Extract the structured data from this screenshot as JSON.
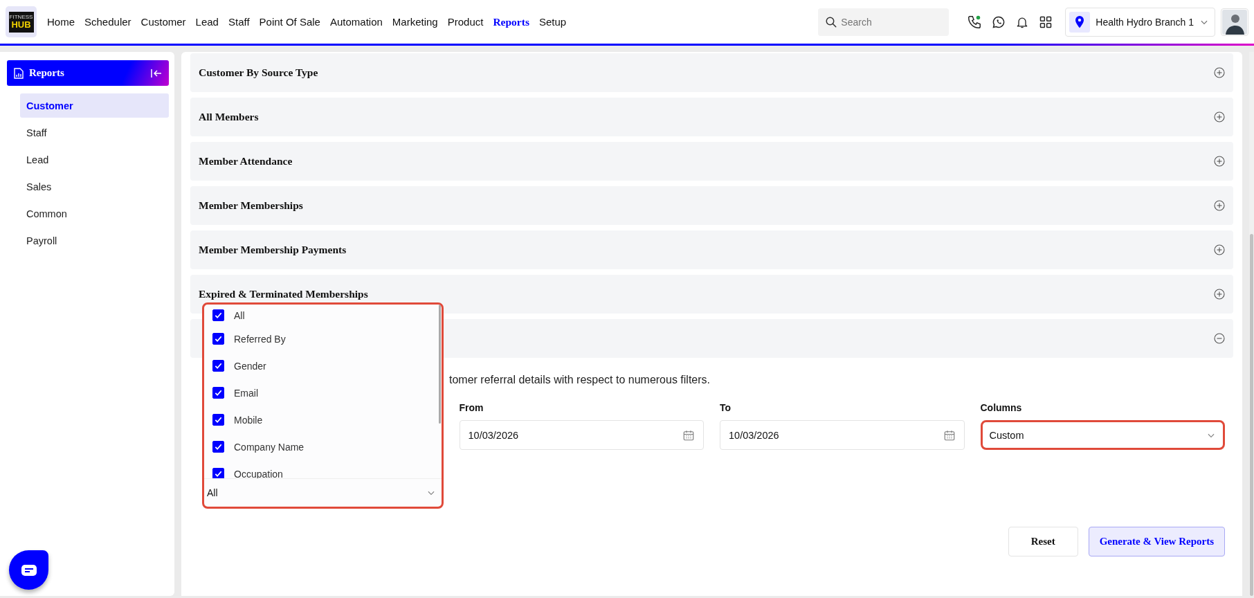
{
  "header": {
    "logo": {
      "lines": [
        "FITNESS",
        "HUB"
      ]
    },
    "nav": [
      {
        "label": "Home",
        "selected": false
      },
      {
        "label": "Scheduler",
        "selected": false
      },
      {
        "label": "Customer",
        "selected": false
      },
      {
        "label": "Lead",
        "selected": false
      },
      {
        "label": "Staff",
        "selected": false
      },
      {
        "label": "Point Of Sale",
        "selected": false
      },
      {
        "label": "Automation",
        "selected": false
      },
      {
        "label": "Marketing",
        "selected": false
      },
      {
        "label": "Product",
        "selected": false
      },
      {
        "label": "Reports",
        "selected": true
      },
      {
        "label": "Setup",
        "selected": false
      }
    ],
    "search": {
      "placeholder": "Search"
    },
    "branch": "Health Hydro Branch 1"
  },
  "sidebar": {
    "title": "Reports",
    "items": [
      {
        "label": "Customer",
        "selected": true
      },
      {
        "label": "Staff",
        "selected": false
      },
      {
        "label": "Lead",
        "selected": false
      },
      {
        "label": "Sales",
        "selected": false
      },
      {
        "label": "Common",
        "selected": false
      },
      {
        "label": "Payroll",
        "selected": false
      }
    ]
  },
  "sections": [
    {
      "title": "Customer By Source Type",
      "expanded": false
    },
    {
      "title": "All Members",
      "expanded": false
    },
    {
      "title": "Member Attendance",
      "expanded": false
    },
    {
      "title": "Member Memberships",
      "expanded": false
    },
    {
      "title": "Member Membership Payments",
      "expanded": false
    },
    {
      "title": "Expired & Terminated Memberships",
      "expanded": false
    },
    {
      "expanded": true
    }
  ],
  "report_form": {
    "description": "tomer referral details with respect to numerous filters.",
    "column_picker": {
      "value": "All",
      "highlighted": true,
      "options": [
        {
          "label": "All",
          "checked": true
        },
        {
          "label": "Referred By",
          "checked": true
        },
        {
          "label": "Gender",
          "checked": true
        },
        {
          "label": "Email",
          "checked": true
        },
        {
          "label": "Mobile",
          "checked": true
        },
        {
          "label": "Company Name",
          "checked": true
        },
        {
          "label": "Occupation",
          "checked": true
        }
      ]
    },
    "from": {
      "label": "From",
      "value": "10/03/2026"
    },
    "to": {
      "label": "To",
      "value": "10/03/2026"
    },
    "columns": {
      "label": "Columns",
      "value": "Custom",
      "highlighted": true
    },
    "buttons": [
      {
        "label": "Reset",
        "kind": "secondary"
      },
      {
        "label": "Generate & View Reports",
        "kind": "primary"
      }
    ]
  }
}
